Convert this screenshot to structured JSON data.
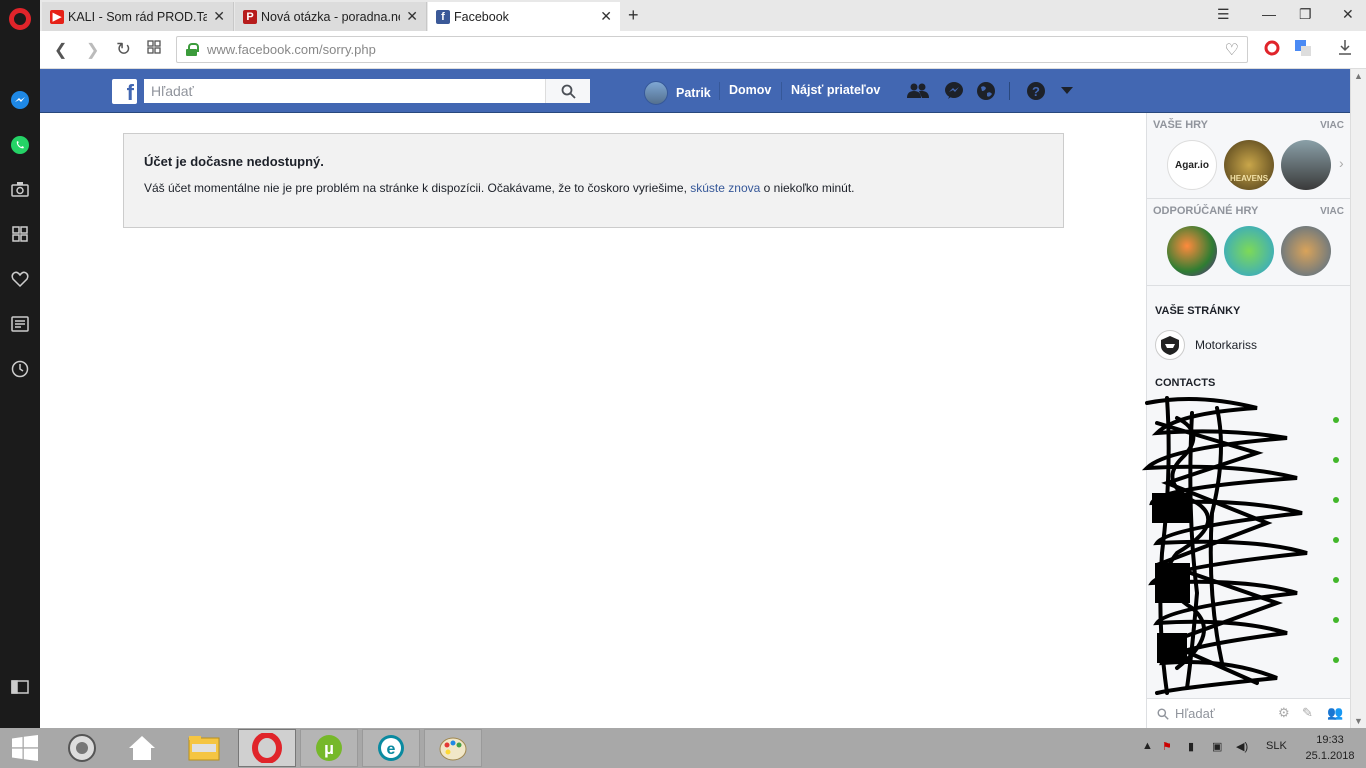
{
  "browser": {
    "tabs": [
      {
        "title": "KALI - Som rád PROD.Taifu",
        "active": false,
        "favicon": "youtube-icon"
      },
      {
        "title": "Nová otázka - poradna.net",
        "active": false,
        "favicon": "poradna-icon"
      },
      {
        "title": "Facebook",
        "active": true,
        "favicon": "facebook-icon"
      }
    ],
    "url_host": "www.facebook.com",
    "url_path": "/sorry.php"
  },
  "fb": {
    "search_placeholder": "Hľadať",
    "user_name": "Patrik",
    "nav_home": "Domov",
    "nav_find_friends": "Nájsť priateľov"
  },
  "notice": {
    "title": "Účet je dočasne nedostupný.",
    "text_before": "Váš účet momentálne nie je pre problém na stránke k dispozícii. Očakávame, že to čoskoro vyriešime, ",
    "link": "skúste znova",
    "text_after": " o niekoľko minút."
  },
  "sidebar": {
    "your_games_header": "VAŠE HRY",
    "more_label": "VIAC",
    "your_games": [
      "Agar.io",
      "HEAVENS",
      ""
    ],
    "recommended_header": "ODPORÚČANÉ HRY",
    "your_pages_header": "VAŠE STRÁNKY",
    "page_name": "Motorkariss",
    "contacts_header": "CONTACTS",
    "chat_search_placeholder": "Hľadať"
  },
  "taskbar": {
    "language": "SLK",
    "time": "19:33",
    "date": "25.1.2018"
  },
  "colors": {
    "fb_blue": "#4267b2",
    "link_blue": "#365899",
    "online_green": "#42b72a",
    "opera_red": "#e0242a"
  }
}
